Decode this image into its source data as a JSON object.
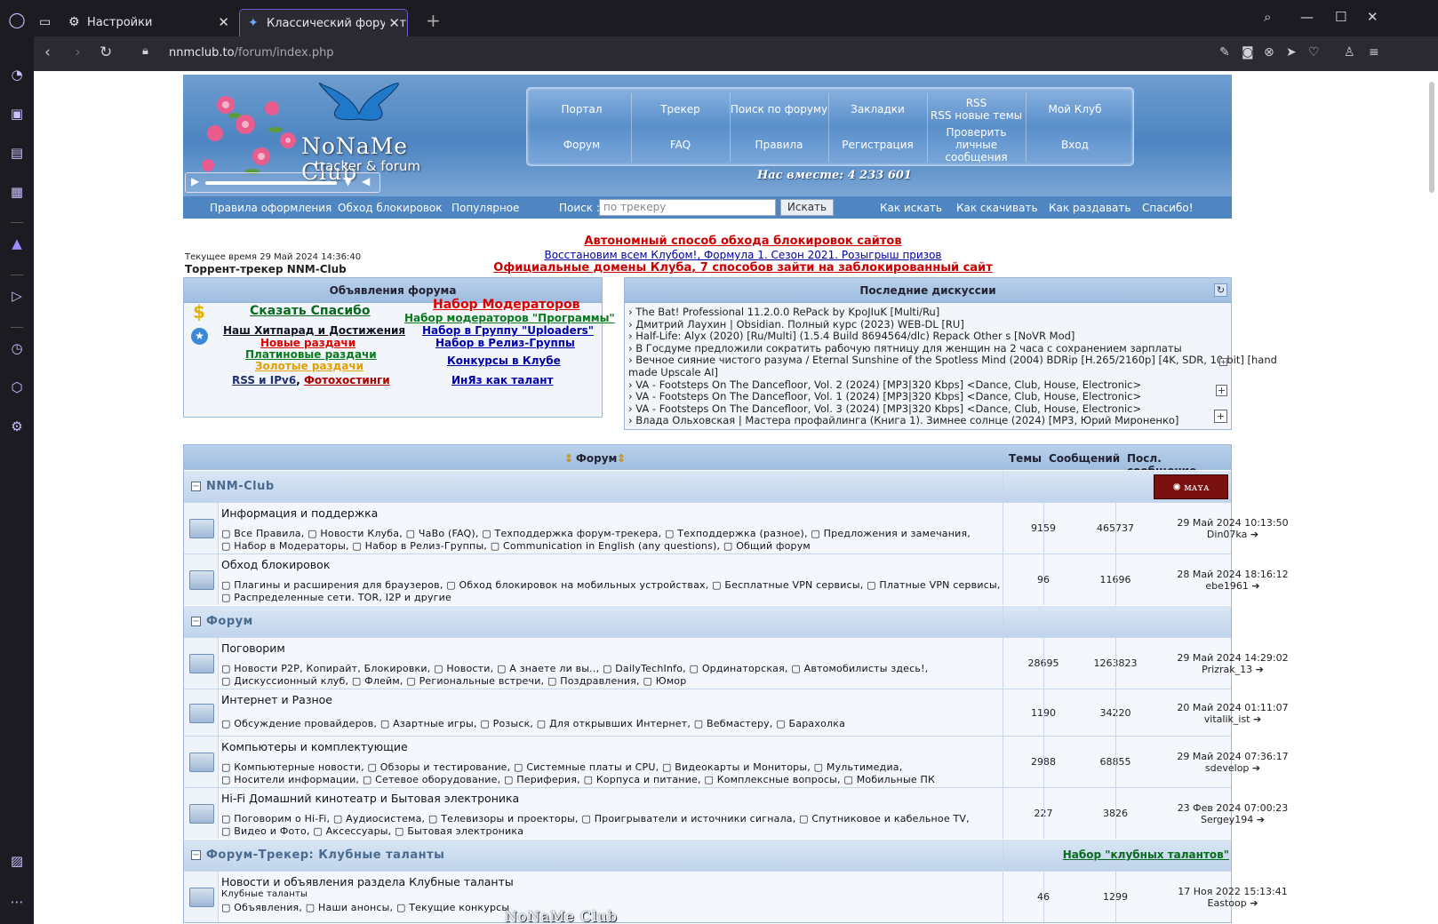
{
  "browser": {
    "tabs": [
      {
        "label": "Настройки"
      },
      {
        "label": "Классический форум-тре"
      }
    ],
    "url_host": "nnmclub.to",
    "url_path": "/forum/index.php"
  },
  "header": {
    "logo_title": "NoNaMe Club",
    "logo_subtitle": "tracker & forum",
    "menu_row1": [
      "Портал",
      "Трекер",
      "Поиск по форуму",
      "Закладки",
      "RSS",
      "Мой Клуб"
    ],
    "rss_sub": "RSS новые темы",
    "menu_row2": [
      "Форум",
      "FAQ",
      "Правила",
      "Регистрация",
      "Проверить личные сообщения",
      "Вход"
    ],
    "together": "Нас вместе: 4 233 601"
  },
  "subnav": {
    "links_left": [
      "Правила оформления",
      "Обход блокировок",
      "Популярное"
    ],
    "search_label": "Поиск :",
    "search_placeholder": "по трекеру",
    "search_button": "Искать",
    "links_right": [
      "Как искать",
      "Как скачивать",
      "Как раздавать",
      "Спасибо!"
    ]
  },
  "info": {
    "time": "Текущее время 29 Май 2024 14:36:40",
    "site": "Торрент-трекер NNM-Club",
    "ann1": "Автономный способ обхода блокировок сайтов",
    "ann2a": "Восстановим всем Клубом!",
    "ann2b": "Формула 1. Сезон 2021. Розыгрыш призов",
    "ann3a": "Официальные домены Клуба",
    "ann3b": "7 способов зайти на заблокированный сайт"
  },
  "announcements": {
    "title": "Объявления форума",
    "say_thanks": "Сказать Спасибо",
    "hitparade": "Наш Хитпарад и Достижения",
    "new_releases": "Новые раздачи",
    "paid_releases": "Платиновые раздачи",
    "gold_releases": "Золотые раздачи",
    "rss_ipv6": "RSS и IPv6",
    "photohosting": "Фотохостинги",
    "moderators": "Набор Модераторов",
    "moderators_programs": "Набор модераторов \"Программы\"",
    "uploaders": "Набор в Группу \"Uploaders\"",
    "release_group": "Набор в Релиз-Группы",
    "contests": "Конкурсы в Клубе",
    "talent": "ИнЯз как талант"
  },
  "discussions": {
    "title": "Последние дискуссии",
    "items": [
      "› The Bat! Professional 11.2.0.0 RePack by KpoJIuK [Multi/Ru]",
      "› Дмитрий Лаухин | Obsidian. Полный курс (2023) WEB-DL [RU]",
      "› Half-Life: Alyx (2020) [Ru/Multi] (1.5.4 Build 8694564/dlc) Repack Other s [NoVR Mod]",
      "› В Госдуме предложили сократить рабочую пятницу для женщин на 2 часа с сохранением зарплаты",
      "› Вечное сияние чистого разума / Eternal Sunshine of the Spotless Mind (2004) BDRip [H.265/2160p] [4K, SDR, 10-bit] [hand",
      "made Upscale AI]",
      "› VA - Footsteps On The Dancefloor, Vol. 2 (2024) [MP3|320 Kbps] <Dance, Club, House, Electronic>",
      "› VA - Footsteps On The Dancefloor, Vol. 1 (2024) [MP3|320 Kbps] <Dance, Club, House, Electronic>",
      "› VA - Footsteps On The Dancefloor, Vol. 3 (2024) [MP3|320 Kbps] <Dance, Club, House, Electronic>",
      "› Влада Ольховская | Мастера профайлинга (Книга 1). Зимнее солнце (2024) [MP3, Юрий Мироненко]"
    ]
  },
  "forum": {
    "headers": {
      "forum": "Форум",
      "topics": "Темы",
      "posts": "Сообщений",
      "last": "Посл. сообщение"
    },
    "cat1": "NNM-Club",
    "cat2": "Форум",
    "cat3": "Форум-Трекер: Клубные таланты",
    "cat3_link": "Набор \"клубных талантов\"",
    "rows": [
      {
        "title": "Информация и поддержка",
        "sub1": "▢ Все Правила, ▢ Новости Клуба, ▢ ЧаВо (FAQ), ▢ Техподдержка форум-трекера, ▢ Техподдержка (разное), ▢ Предложения и замечания,",
        "sub2": "▢ Набор в Модераторы, ▢ Набор в Релиз-Группы, ▢ Communication in English (any questions), ▢ Общий форум",
        "topics": "9159",
        "posts": "465737",
        "date": "29 Май 2024 10:13:50",
        "user": "Din07ka ➔"
      },
      {
        "title": "Обход блокировок",
        "sub1": "▢ Плагины и расширения для браузеров, ▢ Обход блокировок на мобильных устройствах, ▢ Бесплатные VPN сервисы, ▢ Платные VPN сервисы,",
        "sub2": "▢ Распределенные сети. TOR, I2P и другие",
        "topics": "96",
        "posts": "11696",
        "date": "28 Май 2024 18:16:12",
        "user": "ebe1961 ➔"
      },
      {
        "title": "Поговорим",
        "sub1": "▢ Новости P2P, Копирайт, Блокировки, ▢ Новости, ▢ А знаете ли вы.., ▢ DailyTechInfo, ▢ Ординаторская, ▢ Автомобилисты здесь!,",
        "sub2": "▢ Дискуссионный клуб, ▢ Флейм, ▢ Региональные встречи, ▢ Поздравления, ▢ Юмор",
        "topics": "28695",
        "posts": "1263823",
        "date": "29 Май 2024 14:29:02",
        "user": "Prizrak_13 ➔"
      },
      {
        "title": "Интернет и Разное",
        "sub1": "▢ Обсуждение провайдеров, ▢ Азартные игры, ▢ Розыск, ▢ Для открывших Интернет, ▢ Вебмастеру, ▢ Барахолка",
        "sub2": "",
        "topics": "1190",
        "posts": "34220",
        "date": "20 Май 2024 01:11:07",
        "user": "vitalik_ist ➔"
      },
      {
        "title": "Компьютеры и комплектующие",
        "sub1": "▢ Компьютерные новости, ▢ Обзоры и тестирование, ▢ Системные платы и CPU, ▢ Видеокарты и Мониторы, ▢ Мультимедиа,",
        "sub2": "▢ Носители информации, ▢ Сетевое оборудование, ▢ Периферия, ▢ Корпуса и питание, ▢ Комплексные вопросы, ▢ Мобильные ПК",
        "topics": "2988",
        "posts": "68855",
        "date": "29 Май 2024 07:36:17",
        "user": "sdevelop ➔"
      },
      {
        "title": "Hi-Fi Домашний кинотеатр и Бытовая электроника",
        "sub1": "▢ Поговорим о Hi-Fi, ▢ Аудиосистема, ▢ Телевизоры и проекторы, ▢ Проигрыватели и источники сигнала, ▢ Спутниковое и кабельное TV,",
        "sub2": "▢ Видео и Фото, ▢ Аксессуары, ▢ Бытовая электроника",
        "topics": "227",
        "posts": "3826",
        "date": "23 Фев 2024 07:00:23",
        "user": "Sergey194 ➔"
      },
      {
        "title": "Новости и объявления раздела Клубные таланты",
        "sub0": "Клубные таланты",
        "sub1": "▢ Объявления, ▢ Наши анонсы, ▢ Текущие конкурсы",
        "sub2": "",
        "topics": "46",
        "posts": "1299",
        "date": "17 Ноя 2022 15:13:41",
        "user": "Eastoop ➔"
      }
    ],
    "watermark": "NoNaMe Club"
  }
}
